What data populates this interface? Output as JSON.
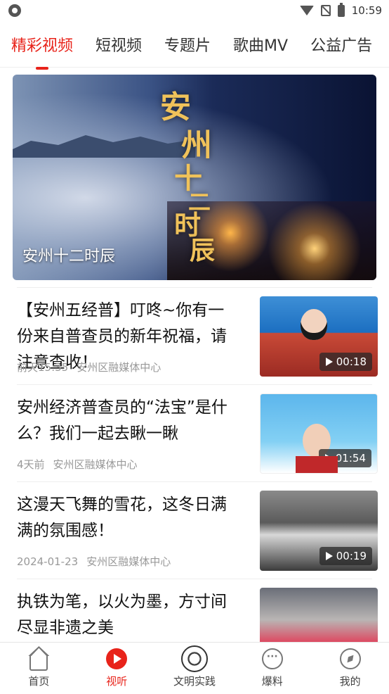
{
  "status_bar": {
    "time": "10:59"
  },
  "tabs": [
    {
      "label": "精彩视频",
      "active": true
    },
    {
      "label": "短视频",
      "active": false
    },
    {
      "label": "专题片",
      "active": false
    },
    {
      "label": "歌曲MV",
      "active": false
    },
    {
      "label": "公益广告",
      "active": false
    }
  ],
  "hero": {
    "art_title": [
      "安",
      "州",
      "十",
      "二",
      "时",
      "辰"
    ],
    "caption": "安州十二时辰"
  },
  "items": [
    {
      "title": "【安州五经普】叮咚~你有一份来自普查员的新年祝福，请注意查收！",
      "time": "前天15:35",
      "source": "安州区融媒体中心",
      "duration": "00:18"
    },
    {
      "title": "安州经济普查员的“法宝”是什么？我们一起去瞅一瞅",
      "time": "4天前",
      "source": "安州区融媒体中心",
      "duration": "01:54"
    },
    {
      "title": "这漫天飞舞的雪花，这冬日满满的氛围感！",
      "time": "2024-01-23",
      "source": "安州区融媒体中心",
      "duration": "00:19"
    },
    {
      "title": "执铁为笔，以火为墨，方寸间尽显非遗之美",
      "time": "",
      "source": "",
      "duration": ""
    }
  ],
  "bottom_nav": [
    {
      "label": "首页",
      "icon": "home-icon",
      "active": false
    },
    {
      "label": "视听",
      "icon": "play-icon",
      "active": true
    },
    {
      "label": "文明实践",
      "icon": "seal-icon",
      "active": false
    },
    {
      "label": "爆料",
      "icon": "chat-icon",
      "active": false
    },
    {
      "label": "我的",
      "icon": "compass-icon",
      "active": false
    }
  ],
  "colors": {
    "accent": "#e8231a",
    "meta": "#999999"
  }
}
